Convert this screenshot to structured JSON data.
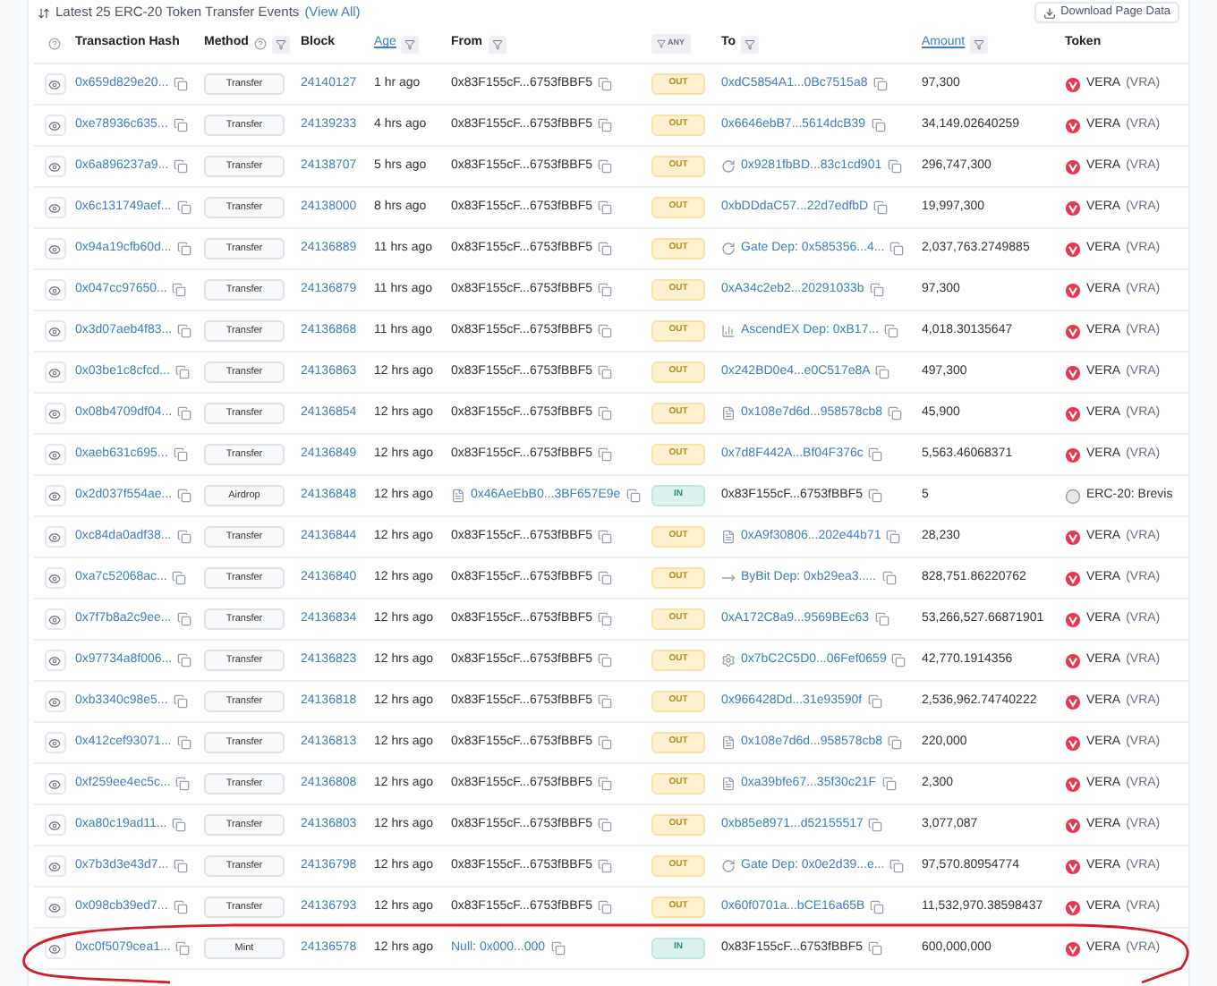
{
  "heading": {
    "text": "Latest 25 ERC-20 Token Transfer Events",
    "link": "(View All)"
  },
  "download_button": "Download Page Data",
  "columns": [
    {
      "label": "Transaction Hash",
      "highlighted": false,
      "filter": false
    },
    {
      "label": "Method",
      "highlighted": false,
      "filter": true
    },
    {
      "label": "Block",
      "highlighted": false,
      "filter": false
    },
    {
      "label": "Age",
      "highlighted": true,
      "filter": true
    },
    {
      "label": "From",
      "highlighted": false,
      "filter": true
    },
    {
      "label": "ANY",
      "filter": true
    },
    {
      "label": "To",
      "highlighted": false,
      "filter": true
    },
    {
      "label": "Amount",
      "highlighted": true,
      "filter": true
    },
    {
      "label": "Token",
      "highlighted": false,
      "filter": false
    }
  ],
  "rows": [
    {
      "hash": "0x659d829e20...",
      "method": "Transfer",
      "block": "24140127",
      "age": "1 hr ago",
      "from": {
        "text": "0x83F155cF...6753fBBF5",
        "link": false,
        "kind": "plain"
      },
      "direction": {
        "label": "OUT",
        "kind": "out"
      },
      "to": {
        "text": "0xdC5854A1...0Bc7515a8",
        "link": true,
        "kind": "plain"
      },
      "amount": "97,300",
      "token": {
        "name": "VERA",
        "symbol": "(VRA)",
        "kind": "vera"
      }
    },
    {
      "hash": "0xe78936c635...",
      "method": "Transfer",
      "block": "24139233",
      "age": "4 hrs ago",
      "from": {
        "text": "0x83F155cF...6753fBBF5",
        "link": false,
        "kind": "plain"
      },
      "direction": {
        "label": "OUT",
        "kind": "out"
      },
      "to": {
        "text": "0x6646ebB7...5614dcB39",
        "link": true,
        "kind": "plain"
      },
      "amount": "34,149.02640259",
      "token": {
        "name": "VERA",
        "symbol": "(VRA)",
        "kind": "vera"
      }
    },
    {
      "hash": "0x6a896237a9...",
      "method": "Transfer",
      "block": "24138707",
      "age": "5 hrs ago",
      "from": {
        "text": "0x83F155cF...6753fBBF5",
        "link": false,
        "kind": "plain"
      },
      "direction": {
        "label": "OUT",
        "kind": "out"
      },
      "to": {
        "text": "0x9281fbBD...83c1cd901",
        "link": true,
        "kind": "exchange"
      },
      "amount": "296,747,300",
      "token": {
        "name": "VERA",
        "symbol": "(VRA)",
        "kind": "vera"
      }
    },
    {
      "hash": "0x6c131749aef...",
      "method": "Transfer",
      "block": "24138000",
      "age": "8 hrs ago",
      "from": {
        "text": "0x83F155cF...6753fBBF5",
        "link": false,
        "kind": "plain"
      },
      "direction": {
        "label": "OUT",
        "kind": "out"
      },
      "to": {
        "text": "0xbDDdaC57...22d7edfbD",
        "link": true,
        "kind": "plain"
      },
      "amount": "19,997,300",
      "token": {
        "name": "VERA",
        "symbol": "(VRA)",
        "kind": "vera"
      }
    },
    {
      "hash": "0x94a19cfb60d...",
      "method": "Transfer",
      "block": "24136889",
      "age": "11 hrs ago",
      "from": {
        "text": "0x83F155cF...6753fBBF5",
        "link": false,
        "kind": "plain"
      },
      "direction": {
        "label": "OUT",
        "kind": "out"
      },
      "to": {
        "text": "Gate Dep: 0x585356...4...",
        "link": true,
        "kind": "exchange"
      },
      "amount": "2,037,763.2749885",
      "token": {
        "name": "VERA",
        "symbol": "(VRA)",
        "kind": "vera"
      }
    },
    {
      "hash": "0x047cc97650...",
      "method": "Transfer",
      "block": "24136879",
      "age": "11 hrs ago",
      "from": {
        "text": "0x83F155cF...6753fBBF5",
        "link": false,
        "kind": "plain"
      },
      "direction": {
        "label": "OUT",
        "kind": "out"
      },
      "to": {
        "text": "0xA34c2eb2...20291033b",
        "link": true,
        "kind": "plain"
      },
      "amount": "97,300",
      "token": {
        "name": "VERA",
        "symbol": "(VRA)",
        "kind": "vera"
      }
    },
    {
      "hash": "0x3d07aeb4f83...",
      "method": "Transfer",
      "block": "24136868",
      "age": "11 hrs ago",
      "from": {
        "text": "0x83F155cF...6753fBBF5",
        "link": false,
        "kind": "plain"
      },
      "direction": {
        "label": "OUT",
        "kind": "out"
      },
      "to": {
        "text": "AscendEX Dep: 0xB17...",
        "link": true,
        "kind": "bars"
      },
      "amount": "4,018.30135647",
      "token": {
        "name": "VERA",
        "symbol": "(VRA)",
        "kind": "vera"
      }
    },
    {
      "hash": "0x03be1c8cfcd...",
      "method": "Transfer",
      "block": "24136863",
      "age": "12 hrs ago",
      "from": {
        "text": "0x83F155cF...6753fBBF5",
        "link": false,
        "kind": "plain"
      },
      "direction": {
        "label": "OUT",
        "kind": "out"
      },
      "to": {
        "text": "0x242BD0e4...e0C517e8A",
        "link": true,
        "kind": "plain"
      },
      "amount": "497,300",
      "token": {
        "name": "VERA",
        "symbol": "(VRA)",
        "kind": "vera"
      }
    },
    {
      "hash": "0x08b4709df04...",
      "method": "Transfer",
      "block": "24136854",
      "age": "12 hrs ago",
      "from": {
        "text": "0x83F155cF...6753fBBF5",
        "link": false,
        "kind": "plain"
      },
      "direction": {
        "label": "OUT",
        "kind": "out"
      },
      "to": {
        "text": "0x108e7d6d...958578cb8",
        "link": true,
        "kind": "contract"
      },
      "amount": "45,900",
      "token": {
        "name": "VERA",
        "symbol": "(VRA)",
        "kind": "vera"
      }
    },
    {
      "hash": "0xaeb631c695...",
      "method": "Transfer",
      "block": "24136849",
      "age": "12 hrs ago",
      "from": {
        "text": "0x83F155cF...6753fBBF5",
        "link": false,
        "kind": "plain"
      },
      "direction": {
        "label": "OUT",
        "kind": "out"
      },
      "to": {
        "text": "0x7d8F442A...Bf04F376c",
        "link": true,
        "kind": "plain"
      },
      "amount": "5,563.46068371",
      "token": {
        "name": "VERA",
        "symbol": "(VRA)",
        "kind": "vera"
      }
    },
    {
      "hash": "0x2d037f554ae...",
      "method": "Airdrop",
      "block": "24136848",
      "age": "12 hrs ago",
      "from": {
        "text": "0x46AeEbB0...3BF657E9e",
        "link": true,
        "kind": "contract"
      },
      "direction": {
        "label": "IN",
        "kind": "in"
      },
      "to": {
        "text": "0x83F155cF...6753fBBF5",
        "link": false,
        "kind": "plain"
      },
      "amount": "5",
      "token": {
        "name": "ERC-20: Brevis",
        "kind": "generic"
      }
    },
    {
      "hash": "0xc84da0adf38...",
      "method": "Transfer",
      "block": "24136844",
      "age": "12 hrs ago",
      "from": {
        "text": "0x83F155cF...6753fBBF5",
        "link": false,
        "kind": "plain"
      },
      "direction": {
        "label": "OUT",
        "kind": "out"
      },
      "to": {
        "text": "0xA9f30806...202e44b71",
        "link": true,
        "kind": "contract"
      },
      "amount": "28,230",
      "token": {
        "name": "VERA",
        "symbol": "(VRA)",
        "kind": "vera"
      }
    },
    {
      "hash": "0xa7c52068ac...",
      "method": "Transfer",
      "block": "24136840",
      "age": "12 hrs ago",
      "from": {
        "text": "0x83F155cF...6753fBBF5",
        "link": false,
        "kind": "plain"
      },
      "direction": {
        "label": "OUT",
        "kind": "out"
      },
      "to": {
        "text": "ByBit Dep: 0xb29ea3.....",
        "link": true,
        "kind": "dash"
      },
      "amount": "828,751.86220762",
      "token": {
        "name": "VERA",
        "symbol": "(VRA)",
        "kind": "vera"
      }
    },
    {
      "hash": "0x7f7b8a2c9ee...",
      "method": "Transfer",
      "block": "24136834",
      "age": "12 hrs ago",
      "from": {
        "text": "0x83F155cF...6753fBBF5",
        "link": false,
        "kind": "plain"
      },
      "direction": {
        "label": "OUT",
        "kind": "out"
      },
      "to": {
        "text": "0xA172C8a9...9569BEc63",
        "link": true,
        "kind": "plain"
      },
      "amount": "53,266,527.66871901",
      "token": {
        "name": "VERA",
        "symbol": "(VRA)",
        "kind": "vera"
      }
    },
    {
      "hash": "0x97734a8f006...",
      "method": "Transfer",
      "block": "24136823",
      "age": "12 hrs ago",
      "from": {
        "text": "0x83F155cF...6753fBBF5",
        "link": false,
        "kind": "plain"
      },
      "direction": {
        "label": "OUT",
        "kind": "out"
      },
      "to": {
        "text": "0x7bC2C5D0...06Fef0659",
        "link": true,
        "kind": "gear"
      },
      "amount": "42,770.1914356",
      "token": {
        "name": "VERA",
        "symbol": "(VRA)",
        "kind": "vera"
      }
    },
    {
      "hash": "0xb3340c98e5...",
      "method": "Transfer",
      "block": "24136818",
      "age": "12 hrs ago",
      "from": {
        "text": "0x83F155cF...6753fBBF5",
        "link": false,
        "kind": "plain"
      },
      "direction": {
        "label": "OUT",
        "kind": "out"
      },
      "to": {
        "text": "0x966428Dd...31e93590f",
        "link": true,
        "kind": "plain"
      },
      "amount": "2,536,962.74740222",
      "token": {
        "name": "VERA",
        "symbol": "(VRA)",
        "kind": "vera"
      }
    },
    {
      "hash": "0x412cef93071...",
      "method": "Transfer",
      "block": "24136813",
      "age": "12 hrs ago",
      "from": {
        "text": "0x83F155cF...6753fBBF5",
        "link": false,
        "kind": "plain"
      },
      "direction": {
        "label": "OUT",
        "kind": "out"
      },
      "to": {
        "text": "0x108e7d6d...958578cb8",
        "link": true,
        "kind": "contract"
      },
      "amount": "220,000",
      "token": {
        "name": "VERA",
        "symbol": "(VRA)",
        "kind": "vera"
      }
    },
    {
      "hash": "0xf259ee4ec5c...",
      "method": "Transfer",
      "block": "24136808",
      "age": "12 hrs ago",
      "from": {
        "text": "0x83F155cF...6753fBBF5",
        "link": false,
        "kind": "plain"
      },
      "direction": {
        "label": "OUT",
        "kind": "out"
      },
      "to": {
        "text": "0xa39bfe67...35f30c21F",
        "link": true,
        "kind": "contract"
      },
      "amount": "2,300",
      "token": {
        "name": "VERA",
        "symbol": "(VRA)",
        "kind": "vera"
      }
    },
    {
      "hash": "0xa80c19ad11...",
      "method": "Transfer",
      "block": "24136803",
      "age": "12 hrs ago",
      "from": {
        "text": "0x83F155cF...6753fBBF5",
        "link": false,
        "kind": "plain"
      },
      "direction": {
        "label": "OUT",
        "kind": "out"
      },
      "to": {
        "text": "0xb85e8971...d52155517",
        "link": true,
        "kind": "plain"
      },
      "amount": "3,077,087",
      "token": {
        "name": "VERA",
        "symbol": "(VRA)",
        "kind": "vera"
      }
    },
    {
      "hash": "0x7b3d3e43d7...",
      "method": "Transfer",
      "block": "24136798",
      "age": "12 hrs ago",
      "from": {
        "text": "0x83F155cF...6753fBBF5",
        "link": false,
        "kind": "plain"
      },
      "direction": {
        "label": "OUT",
        "kind": "out"
      },
      "to": {
        "text": "Gate Dep: 0x0e2d39...e...",
        "link": true,
        "kind": "exchange"
      },
      "amount": "97,570.80954774",
      "token": {
        "name": "VERA",
        "symbol": "(VRA)",
        "kind": "vera"
      }
    },
    {
      "hash": "0x098cb39ed7...",
      "method": "Transfer",
      "block": "24136793",
      "age": "12 hrs ago",
      "from": {
        "text": "0x83F155cF...6753fBBF5",
        "link": false,
        "kind": "plain"
      },
      "direction": {
        "label": "OUT",
        "kind": "out"
      },
      "to": {
        "text": "0x60f0701a...bCE16a65B",
        "link": true,
        "kind": "plain"
      },
      "amount": "11,532,970.38598437",
      "token": {
        "name": "VERA",
        "symbol": "(VRA)",
        "kind": "vera"
      }
    },
    {
      "hash": "0xc0f5079cea1...",
      "method": "Mint",
      "block": "24136578",
      "age": "12 hrs ago",
      "from": {
        "text": "Null: 0x000...000",
        "link": true,
        "kind": "plain"
      },
      "direction": {
        "label": "IN",
        "kind": "in"
      },
      "to": {
        "text": "0x83F155cF...6753fBBF5",
        "link": false,
        "kind": "plain"
      },
      "amount": "600,000,000",
      "token": {
        "name": "VERA",
        "symbol": "(VRA)",
        "kind": "vera"
      }
    }
  ]
}
